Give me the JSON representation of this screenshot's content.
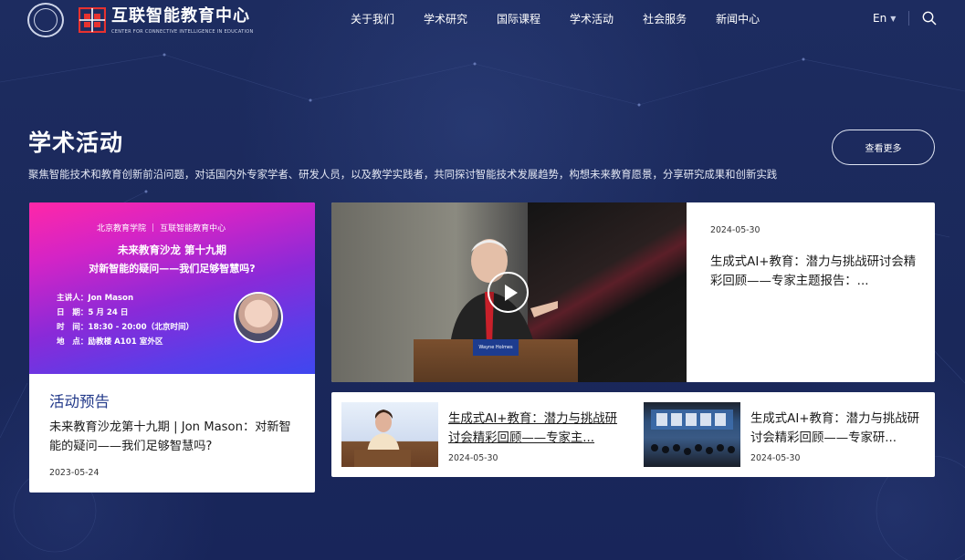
{
  "header": {
    "brand_cn": "互联智能教育中心",
    "brand_en": "CENTER FOR CONNECTIVE INTELLIGENCE IN EDUCATION",
    "nav": [
      "关于我们",
      "学术研究",
      "国际课程",
      "学术活动",
      "社会服务",
      "新闻中心"
    ],
    "lang": "En"
  },
  "section": {
    "title": "学术活动",
    "description": "聚焦智能技术和教育创新前沿问题，对话国内外专家学者、研发人员，以及教学实践者，共同探讨智能技术发展趋势，构想未来教育愿景，分享研究成果和创新实践",
    "more_label": "查看更多"
  },
  "featured": {
    "poster": {
      "logo_left": "北京教育学院",
      "logo_right": "互联智能教育中心",
      "title_line1": "未来教育沙龙 第十九期",
      "title_line2": "对新智能的疑问——我们足够智慧吗?",
      "speaker": "主讲人：Jon Mason",
      "date": "日　期：5 月 24 日",
      "time": "时　间：18:30 - 20:00（北京时间）",
      "place": "地　点：励教楼 A101 室外区"
    },
    "tag": "活动预告",
    "title": "未来教育沙龙第十九期 | Jon Mason：对新智能的疑问——我们足够智慧吗?",
    "date": "2023-05-24"
  },
  "video_card": {
    "podium_label": "Wayne Holmes",
    "date": "2024-05-30",
    "title": "生成式AI+教育：潜力与挑战研讨会精彩回顾——专家主题报告：..."
  },
  "news": [
    {
      "title": "生成式AI+教育：潜力与挑战研讨会精彩回顾——专家主...",
      "date": "2024-05-30"
    },
    {
      "title": "生成式AI+教育：潜力与挑战研讨会精彩回顾——专家研...",
      "date": "2024-05-30"
    }
  ],
  "colors": {
    "background": "#1b2a5c",
    "accent_tag": "#233a8a",
    "brand_red": "#e8322f"
  },
  "icons": {
    "search": "search-icon",
    "lang_caret": "caret-down-icon",
    "play": "play-icon"
  }
}
